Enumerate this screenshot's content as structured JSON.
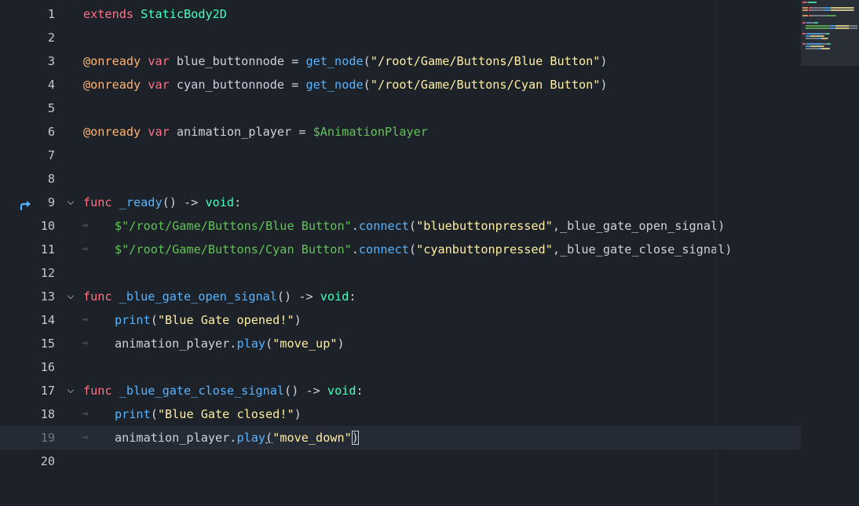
{
  "editor": {
    "colors": {
      "background": "#1d2229",
      "current_line": "#252b34",
      "keyword": "#ff7085",
      "type": "#42ffc2",
      "annotation": "#ffb373",
      "function": "#57b3ff",
      "string": "#ffeda1",
      "node_path": "#63c259"
    },
    "current_line": 19,
    "gutter_icons": [
      {
        "line": 9,
        "icon": "connected-signal-arrow-icon"
      }
    ],
    "lines": [
      {
        "n": "1",
        "tokens": [
          {
            "t": "extends",
            "c": "kw"
          },
          {
            "t": " "
          },
          {
            "t": "StaticBody2D",
            "c": "type"
          }
        ]
      },
      {
        "n": "2",
        "tokens": []
      },
      {
        "n": "3",
        "tokens": [
          {
            "t": "@onready",
            "c": "anno"
          },
          {
            "t": " "
          },
          {
            "t": "var",
            "c": "kw"
          },
          {
            "t": " blue_buttonnode = "
          },
          {
            "t": "get_node",
            "c": "fn"
          },
          {
            "t": "("
          },
          {
            "t": "\"/root/Game/Buttons/Blue Button\"",
            "c": "str"
          },
          {
            "t": ")"
          }
        ]
      },
      {
        "n": "4",
        "tokens": [
          {
            "t": "@onready",
            "c": "anno"
          },
          {
            "t": " "
          },
          {
            "t": "var",
            "c": "kw"
          },
          {
            "t": " cyan_buttonnode = "
          },
          {
            "t": "get_node",
            "c": "fn"
          },
          {
            "t": "("
          },
          {
            "t": "\"/root/Game/Buttons/Cyan Button\"",
            "c": "str"
          },
          {
            "t": ")"
          }
        ]
      },
      {
        "n": "5",
        "tokens": []
      },
      {
        "n": "6",
        "tokens": [
          {
            "t": "@onready",
            "c": "anno"
          },
          {
            "t": " "
          },
          {
            "t": "var",
            "c": "kw"
          },
          {
            "t": " animation_player = "
          },
          {
            "t": "$AnimationPlayer",
            "c": "node"
          }
        ]
      },
      {
        "n": "7",
        "tokens": []
      },
      {
        "n": "8",
        "tokens": []
      },
      {
        "n": "9",
        "fold": true,
        "tokens": [
          {
            "t": "func",
            "c": "kw"
          },
          {
            "t": " "
          },
          {
            "t": "_ready",
            "c": "fn"
          },
          {
            "t": "() -> "
          },
          {
            "t": "void",
            "c": "type"
          },
          {
            "t": ":"
          }
        ]
      },
      {
        "n": "10",
        "indent": true,
        "tokens": [
          {
            "t": "$\"/root/Game/Buttons/Blue Button\"",
            "c": "node"
          },
          {
            "t": "."
          },
          {
            "t": "connect",
            "c": "fn"
          },
          {
            "t": "("
          },
          {
            "t": "\"bluebuttonpressed\"",
            "c": "str"
          },
          {
            "t": ",_blue_gate_open_signal)"
          }
        ]
      },
      {
        "n": "11",
        "indent": true,
        "tokens": [
          {
            "t": "$\"/root/Game/Buttons/Cyan Button\"",
            "c": "node"
          },
          {
            "t": "."
          },
          {
            "t": "connect",
            "c": "fn"
          },
          {
            "t": "("
          },
          {
            "t": "\"cyanbuttonpressed\"",
            "c": "str"
          },
          {
            "t": ",_blue_gate_close_signal)"
          }
        ]
      },
      {
        "n": "12",
        "tokens": []
      },
      {
        "n": "13",
        "fold": true,
        "tokens": [
          {
            "t": "func",
            "c": "kw"
          },
          {
            "t": " "
          },
          {
            "t": "_blue_gate_open_signal",
            "c": "fn"
          },
          {
            "t": "() -> "
          },
          {
            "t": "void",
            "c": "type"
          },
          {
            "t": ":"
          }
        ]
      },
      {
        "n": "14",
        "indent": true,
        "tokens": [
          {
            "t": "print",
            "c": "fn"
          },
          {
            "t": "("
          },
          {
            "t": "\"Blue Gate opened!\"",
            "c": "str"
          },
          {
            "t": ")"
          }
        ]
      },
      {
        "n": "15",
        "indent": true,
        "tokens": [
          {
            "t": "animation_player."
          },
          {
            "t": "play",
            "c": "fn"
          },
          {
            "t": "("
          },
          {
            "t": "\"move_up\"",
            "c": "str"
          },
          {
            "t": ")"
          }
        ]
      },
      {
        "n": "16",
        "tokens": []
      },
      {
        "n": "17",
        "fold": true,
        "tokens": [
          {
            "t": "func",
            "c": "kw"
          },
          {
            "t": " "
          },
          {
            "t": "_blue_gate_close_signal",
            "c": "fn"
          },
          {
            "t": "() -> "
          },
          {
            "t": "void",
            "c": "type"
          },
          {
            "t": ":"
          }
        ]
      },
      {
        "n": "18",
        "indent": true,
        "tokens": [
          {
            "t": "print",
            "c": "fn"
          },
          {
            "t": "("
          },
          {
            "t": "\"Blue Gate closed!\"",
            "c": "str"
          },
          {
            "t": ")"
          }
        ]
      },
      {
        "n": "19",
        "indent": true,
        "tokens": [
          {
            "t": "animation_player."
          },
          {
            "t": "play",
            "c": "fn"
          },
          {
            "t": "(",
            "c": "paren-hl"
          },
          {
            "t": "\"move_down\"",
            "c": "str"
          },
          {
            "t": ")",
            "c": "caret-box"
          }
        ]
      },
      {
        "n": "20",
        "tokens": []
      }
    ]
  }
}
